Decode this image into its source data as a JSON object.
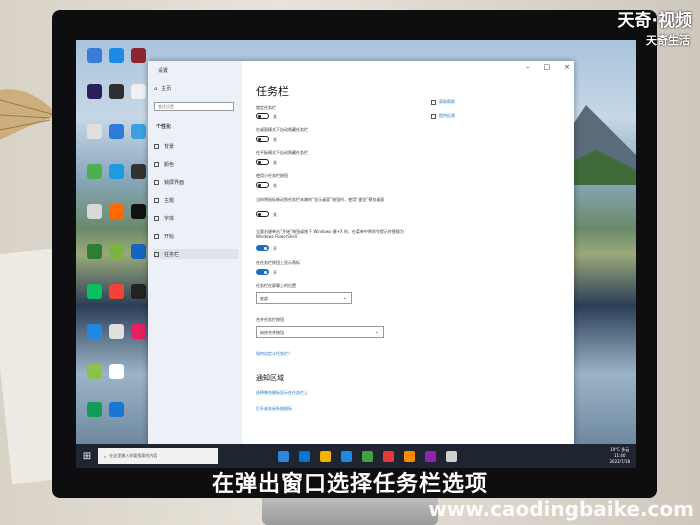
{
  "caption": "在弹出窗口选择任务栏选项",
  "logo": {
    "line1": "天奇·视频",
    "line2": "天奇生活"
  },
  "watermark": "www.caodingbaike.com",
  "settings": {
    "window_title": "设置",
    "home": "主页",
    "search_placeholder": "查找设置",
    "section": "个性化",
    "nav": [
      "背景",
      "颜色",
      "锁屏界面",
      "主题",
      "字体",
      "开始",
      "任务栏"
    ],
    "page_title": "任务栏",
    "related": [
      "获取帮助",
      "提供反馈"
    ],
    "toggles": [
      {
        "label": "锁定任务栏",
        "state": "关"
      },
      {
        "label": "在桌面模式下自动隐藏任务栏",
        "state": "关"
      },
      {
        "label": "在平板模式下自动隐藏任务栏",
        "state": "关"
      },
      {
        "label": "使用小任务栏按钮",
        "state": "关"
      },
      {
        "label": "当你将鼠标移动到任务栏末端的“显示桌面”按钮时，使用“速览”预览桌面",
        "state": "关"
      },
      {
        "label": "当我右键单击“开始”按钮或按下 Windows 键+X 时，在菜单中将命令提示符替换为 Windows PowerShell",
        "state": "开"
      },
      {
        "label": "在任务栏按钮上显示角标",
        "state": "开"
      }
    ],
    "position_label": "任务栏在屏幕上的位置",
    "position_value": "底部",
    "combine_label": "合并任务栏按钮",
    "combine_value": "始终合并按钮",
    "customize_link": "如何自定义任务栏？",
    "notification_title": "通知区域",
    "notification_links": [
      "选择哪些图标显示在任务栏上",
      "打开或关闭系统图标"
    ]
  },
  "taskbar": {
    "search_placeholder": "在这里输入你要搜索的内容",
    "weather": "19°C 多云",
    "time": "11:40",
    "date": "2022/7/18"
  },
  "colors": {
    "accent": "#1a6fc2",
    "taskbar": "#1f2530"
  }
}
